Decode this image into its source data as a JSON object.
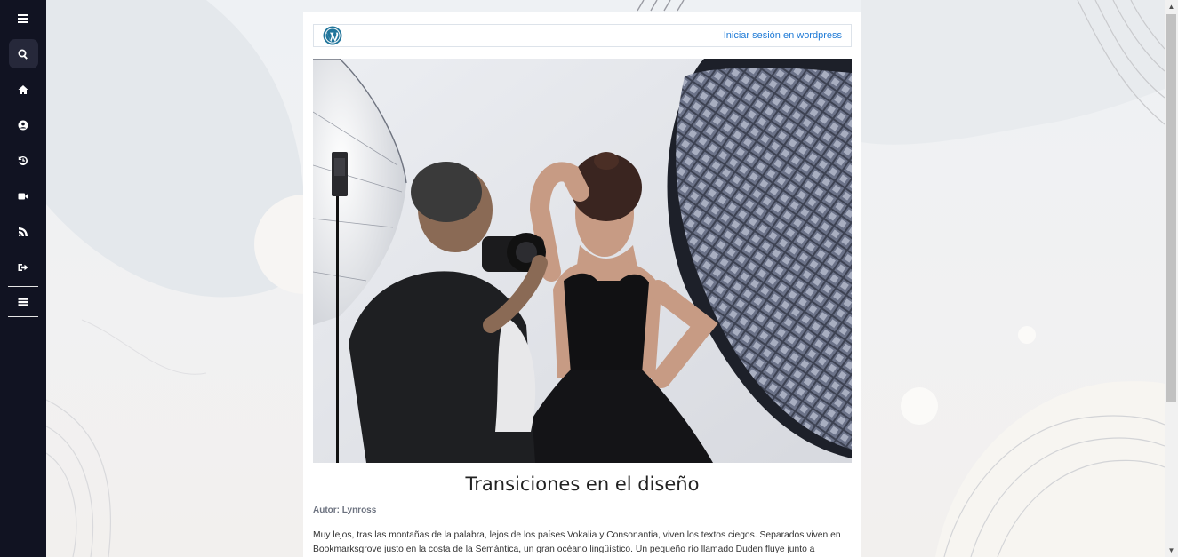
{
  "sidebar": {
    "items": [
      {
        "name": "menu",
        "icon": "hamburger-icon"
      },
      {
        "name": "search",
        "icon": "search-icon",
        "active": true
      },
      {
        "name": "home",
        "icon": "home-icon"
      },
      {
        "name": "profile",
        "icon": "user-circle-icon"
      },
      {
        "name": "history",
        "icon": "history-icon"
      },
      {
        "name": "video",
        "icon": "video-camera-icon"
      },
      {
        "name": "blog",
        "icon": "blogger-icon"
      },
      {
        "name": "logout",
        "icon": "sign-out-icon"
      },
      {
        "name": "more",
        "icon": "stack-icon"
      }
    ],
    "colors": {
      "background": "#111322",
      "active": "#26283a",
      "icon": "#ffffff"
    }
  },
  "wordpress_bar": {
    "logo_icon": "wordpress-icon",
    "login_link": "Iniciar sesión en wordpress",
    "link_color": "#1e7ad6"
  },
  "post": {
    "image_description_icon": "photo-studio-image",
    "title": "Transiciones en el diseño",
    "author": "Autor: Lynross",
    "body": "Muy lejos, tras las montañas de la palabra, lejos de los países Vokalia y Consonantia, viven los textos ciegos. Separados viven en Bookmarksgrove justo en la costa de la Semántica, un gran océano lingüístico. Un pequeño río llamado Duden fluye junto a"
  },
  "scrollbar": {
    "up_icon": "▲",
    "down_icon": "▼"
  }
}
